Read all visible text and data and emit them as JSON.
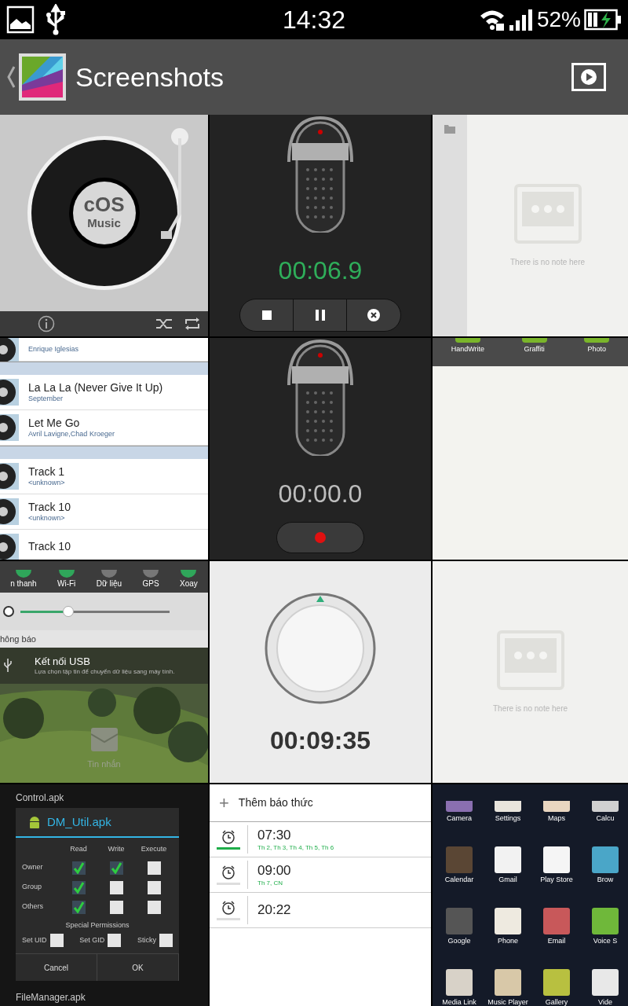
{
  "status_bar": {
    "time": "14:32",
    "battery": "52%"
  },
  "action_bar": {
    "title": "Screenshots"
  },
  "thumbnails": [
    {
      "kind": "music",
      "disc_title": "cOS",
      "disc_subtitle": "Music"
    },
    {
      "kind": "recorder",
      "recording": true,
      "time": "00:06.9"
    },
    {
      "kind": "note_empty",
      "message": "There is no note here",
      "sidebar": true
    },
    {
      "kind": "songs",
      "items": [
        {
          "kind": "song",
          "artist": "Enrique Iglesias"
        },
        {
          "kind": "divider"
        },
        {
          "kind": "song",
          "title": "La La La (Never Give It Up)",
          "artist": "September"
        },
        {
          "kind": "song",
          "title": "Let Me Go",
          "artist": "Avril Lavigne,Chad Kroeger"
        },
        {
          "kind": "divider"
        },
        {
          "kind": "song",
          "title": "Track 1",
          "artist": "<unknown>"
        },
        {
          "kind": "song",
          "title": "Track 10",
          "artist": "<unknown>"
        },
        {
          "kind": "song",
          "title": "Track 10"
        }
      ]
    },
    {
      "kind": "recorder",
      "recording": false,
      "time": "00:00.0"
    },
    {
      "kind": "note_tabs",
      "tabs": [
        "HandWrite",
        "Graffiti",
        "Photo"
      ]
    },
    {
      "kind": "quick_settings",
      "toggles": [
        {
          "label": "n thanh",
          "on": true
        },
        {
          "label": "Wi-Fi",
          "on": true
        },
        {
          "label": "Dữ liệu",
          "on": false
        },
        {
          "label": "GPS",
          "on": false
        },
        {
          "label": "Xoay",
          "on": true
        }
      ],
      "brightness": {
        "level": 0.32
      },
      "section": "hông báo",
      "notification": {
        "title": "Kết nối USB",
        "text": "Lựa chọn tập tin để chuyển dữ liệu sang máy tính."
      },
      "app_label": "Tin nhắn"
    },
    {
      "kind": "timer",
      "time": "00:09:35"
    },
    {
      "kind": "note_empty",
      "message": "There is no note here",
      "sidebar": false
    },
    {
      "kind": "file_dialog",
      "files": [
        "Control.apk",
        "FileManager.apk"
      ],
      "title": "DM_Util.apk",
      "columns": [
        "Read",
        "Write",
        "Execute"
      ],
      "rows": [
        {
          "label": "Owner",
          "checks": [
            {
              "checked": true
            },
            {
              "checked": true
            },
            {
              "checked": false
            }
          ]
        },
        {
          "label": "Group",
          "checks": [
            {
              "checked": true
            },
            {
              "checked": false
            },
            {
              "checked": false
            }
          ]
        },
        {
          "label": "Others",
          "checks": [
            {
              "checked": true
            },
            {
              "checked": false
            },
            {
              "checked": false
            }
          ]
        }
      ],
      "special_title": "Special Permissions",
      "special": [
        {
          "label": "Set UID",
          "checked": false
        },
        {
          "label": "Set GID",
          "checked": false
        },
        {
          "label": "Sticky",
          "checked": false
        }
      ],
      "buttons": [
        "Cancel",
        "OK"
      ]
    },
    {
      "kind": "alarms",
      "add_icon": "+",
      "add_label": "Thêm báo thức",
      "alarms": [
        {
          "time": "07:30",
          "days": "Th 2, Th 3, Th 4, Th 5, Th 6",
          "on": true
        },
        {
          "time": "09:00",
          "days": "Th 7, CN",
          "on": false
        },
        {
          "time": "20:22",
          "on": false
        }
      ]
    },
    {
      "kind": "app_drawer",
      "apps": [
        {
          "label": "Camera",
          "color": "#8a6fb0"
        },
        {
          "label": "Settings",
          "color": "#e8e4dc"
        },
        {
          "label": "Maps",
          "color": "#e9d6c0"
        },
        {
          "label": "Calcu",
          "color": "#d0d0d0"
        },
        {
          "label": "Calendar",
          "color": "#5a4634"
        },
        {
          "label": "Gmail",
          "color": "#f2f2f2"
        },
        {
          "label": "Play Store",
          "color": "#f5f5f5"
        },
        {
          "label": "Brow",
          "color": "#4aa6c8"
        },
        {
          "label": "Google",
          "color": "#555555"
        },
        {
          "label": "Phone",
          "color": "#eeeae0"
        },
        {
          "label": "Email",
          "color": "#c8585a"
        },
        {
          "label": "Voice S",
          "color": "#6fb83a"
        },
        {
          "label": "Media Link",
          "color": "#d8d2c8"
        },
        {
          "label": "Music Player",
          "color": "#d8c8a8"
        },
        {
          "label": "Gallery",
          "color": "#b8c040"
        },
        {
          "label": "Vide",
          "color": "#e8e8e8"
        }
      ]
    }
  ]
}
